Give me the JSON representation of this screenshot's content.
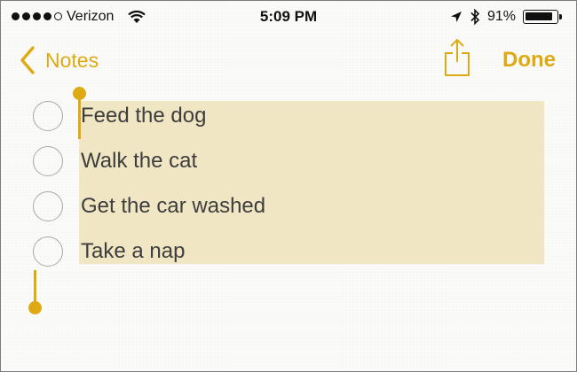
{
  "status_bar": {
    "carrier": "Verizon",
    "time": "5:09 PM",
    "battery_percent": "91%",
    "battery_level": 0.91,
    "signal_bars_filled": 4,
    "signal_bars_total": 5,
    "icons": [
      "wifi-icon",
      "location-arrow-icon",
      "bluetooth-icon",
      "battery-icon"
    ]
  },
  "nav": {
    "back_label": "Notes",
    "done_label": "Done",
    "share_icon": "share-icon"
  },
  "checklist": {
    "items": [
      {
        "label": "Feed the dog",
        "checked": false
      },
      {
        "label": "Walk the cat",
        "checked": false
      },
      {
        "label": "Get the car washed",
        "checked": false
      },
      {
        "label": "Take a nap",
        "checked": false
      }
    ]
  },
  "colors": {
    "accent": "#deaa14",
    "selection": "#f1e6c4",
    "text": "#3d3d3d",
    "circle": "#a8a8a8"
  }
}
